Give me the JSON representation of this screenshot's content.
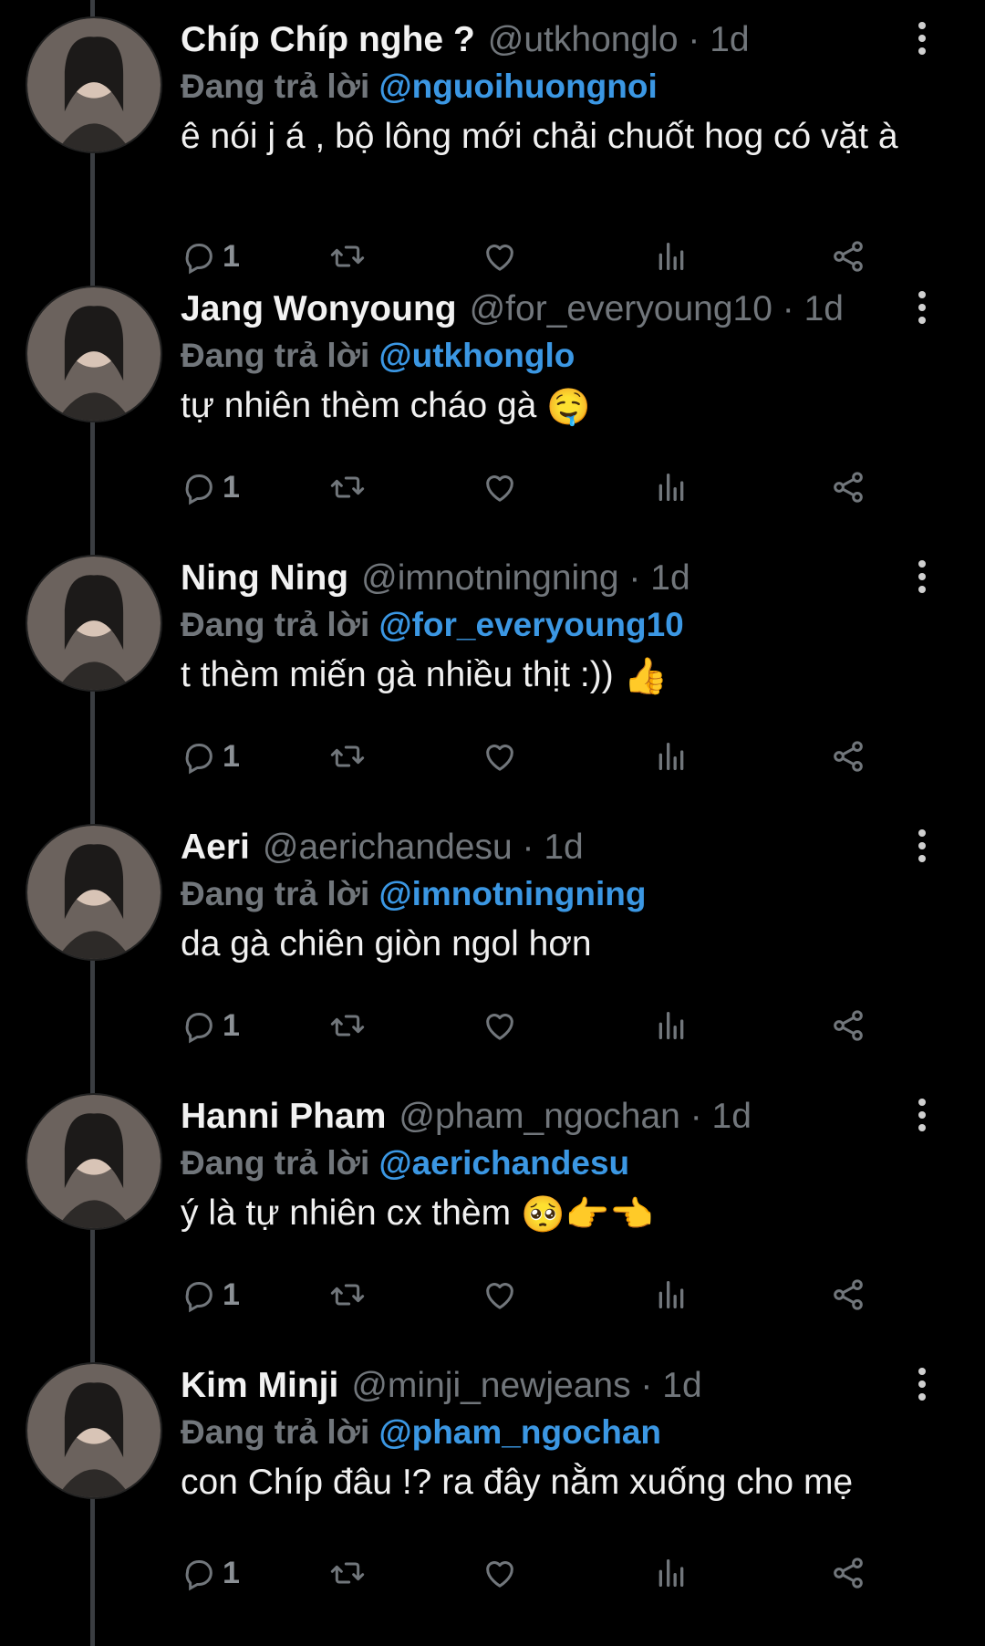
{
  "reply_prefix": "Đang trả lời",
  "accent_color": "#3b97e3",
  "tweets": [
    {
      "name": "Chíp Chíp nghe ?",
      "handle": "@utkhonglo",
      "time": "1d",
      "reply_to": "@nguoihuongnoi",
      "text": "ê nói j á , bộ lông mới chải chuốt hog có vặt à",
      "reply_count": "1",
      "avatar_icon": "avatar-photo"
    },
    {
      "name": "Jang Wonyoung",
      "handle": "@for_everyoung10",
      "time": "1d",
      "reply_to": "@utkhonglo",
      "text": "tự nhiên thèm cháo gà",
      "emoji": "🤤",
      "reply_count": "1",
      "avatar_icon": "avatar-photo"
    },
    {
      "name": "Ning Ning",
      "handle": "@imnotningning",
      "time": "1d",
      "reply_to": "@for_everyoung10",
      "text": "t thèm miến gà nhiều thịt :))",
      "emoji": "👍",
      "reply_count": "1",
      "avatar_icon": "avatar-photo"
    },
    {
      "name": "Aeri",
      "handle": "@aerichandesu",
      "time": "1d",
      "reply_to": "@imnotningning",
      "text": "da gà chiên giòn ngol hơn",
      "reply_count": "1",
      "avatar_icon": "avatar-photo"
    },
    {
      "name": "Hanni Pham",
      "handle": "@pham_ngochan",
      "time": "1d",
      "reply_to": "@aerichandesu",
      "text": "ý là tự nhiên cx thèm",
      "emoji": "🥺👉👈",
      "reply_count": "1",
      "avatar_icon": "avatar-photo"
    },
    {
      "name": "Kim Minji",
      "handle": "@minji_newjeans",
      "time": "1d",
      "reply_to": "@pham_ngochan",
      "text": "con Chíp đâu !? ra đây nằm xuống cho mẹ",
      "reply_count": "1",
      "avatar_icon": "avatar-photo"
    }
  ]
}
